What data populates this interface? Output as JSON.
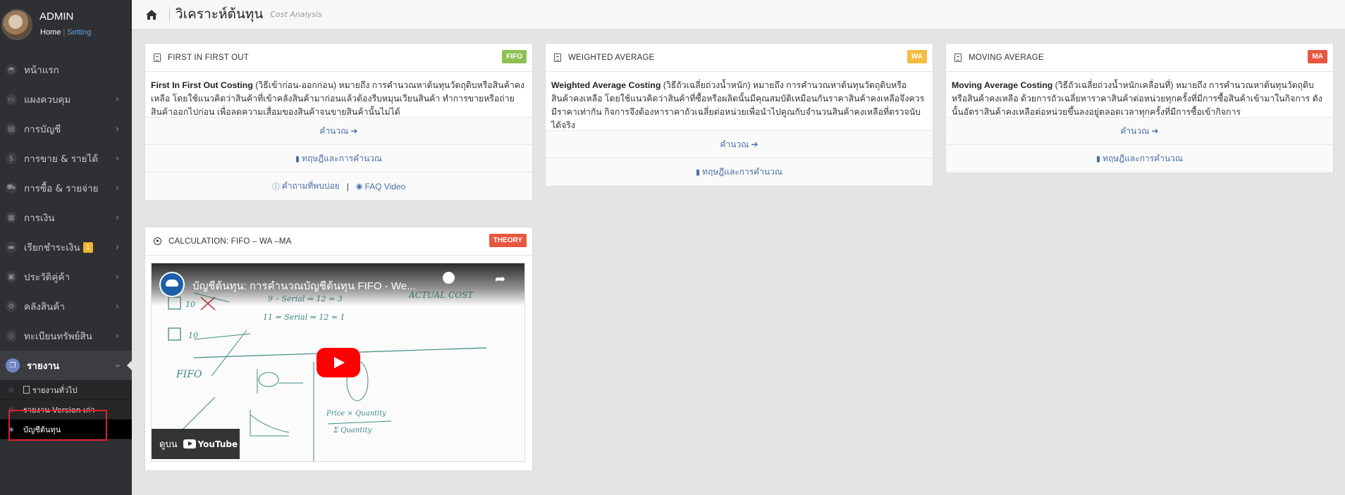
{
  "profile": {
    "name": "ADMIN",
    "home": "Home",
    "setting": "Setting"
  },
  "sidebar": {
    "items": [
      {
        "label": "หน้าแรก",
        "icon": "dashboard-icon",
        "glyph": "◓"
      },
      {
        "label": "แผงควบคุม",
        "icon": "monitor-icon",
        "glyph": "▭"
      },
      {
        "label": "การบัญชี",
        "icon": "book-icon",
        "glyph": "▤"
      },
      {
        "label": "การขาย & รายได้",
        "icon": "dollar-icon",
        "glyph": "$"
      },
      {
        "label": "การซื้อ & รายจ่าย",
        "icon": "cart-icon",
        "glyph": "⛟"
      },
      {
        "label": "การเงิน",
        "icon": "calendar-icon",
        "glyph": "▦"
      },
      {
        "label": "เรียกชำระเงิน",
        "icon": "card-icon",
        "glyph": "▬",
        "badge": "1"
      },
      {
        "label": "ประวัติคู่ค้า",
        "icon": "contacts-icon",
        "glyph": "▣"
      },
      {
        "label": "คลังสินค้า",
        "icon": "boxes-icon",
        "glyph": "⚙"
      },
      {
        "label": "ทะเบียนทรัพย์สิน",
        "icon": "diamond-icon",
        "glyph": "◇"
      }
    ],
    "active": {
      "label": "รายงาน",
      "icon": "report-icon"
    },
    "sub": [
      {
        "label": "รายงานทั่วไป"
      },
      {
        "label": "รายงาน Version เก่า"
      },
      {
        "label": "บัญชีต้นทุน"
      }
    ]
  },
  "header": {
    "title": "วิเคราะห์ต้นทุน",
    "subtitle": "Cost Analysis"
  },
  "cards": {
    "fifo": {
      "title": "FIRST IN FIRST OUT",
      "tag": "FIFO",
      "tag_color": "#8cc152",
      "term": "First In First Out Costing",
      "desc": " (วิธีเข้าก่อน-ออกก่อน) หมายถึง การคำนวณหาต้นทุนวัตถุดิบหรือสินค้าคงเหลือ โดยใช้แนวคิดว่าสินค้าที่เข้าคลังสินค้ามาก่อนแล้วต้องรีบหมุนเวียนสินค้า ทำการขายหรือถ่ายสินค้าออกไปก่อน เพื่อลดความเสื่อมของสินค้าจนขายสินค้านั้นไม่ได้",
      "calc": "คำนวณ ➔",
      "theory": "ทฤษฎีและการคำนวณ",
      "faq": "คำถามที่พบบ่อย",
      "faq_video": "FAQ Video"
    },
    "wa": {
      "title": "WEIGHTED AVERAGE",
      "tag": "WA",
      "tag_color": "#f6bb42",
      "term": "Weighted Average Costing",
      "desc": " (วิธีถัวเฉลี่ยถ่วงน้ำหนัก) หมายถึง การคำนวณหาต้นทุนวัตถุดิบหรือสินค้าคงเหลือ โดยใช้แนวคิดว่าสินค้าที่ซื้อหรือผลิตนั้นมีคุณสมบัติเหมือนกันราคาสินค้าคงเหลือจึงควรมีราคาเท่ากัน กิจการจึงต้องหาราคาถัวเฉลี่ยต่อหน่วยเพื่อนำไปคูณกับจำนวนสินค้าคงเหลือที่ตรวจนับได้จริง",
      "calc": "คำนวณ ➔",
      "theory": "ทฤษฎีและการคำนวณ"
    },
    "ma": {
      "title": "MOVING AVERAGE",
      "tag": "MA",
      "tag_color": "#e9573f",
      "term": "Moving Average Costing",
      "desc": " (วิธีถัวเฉลี่ยถ่วงน้ำหนักเคลื่อนที่) หมายถึง การคำนวณหาต้นทุนวัตถุดิบหรือสินค้าคงเหลือ ด้วยการถัวเฉลี่ยหาราคาสินค้าต่อหน่วยทุกครั้งที่มีการซื้อสินค้าเข้ามาในกิจการ ดังนั้นอัตราสินค้าคงเหลือต่อหน่วยขึ้นลงอยู่ตลอดเวลาทุกครั้งที่มีการซื้อเข้ากิจการ",
      "calc": "คำนวณ ➔",
      "theory": "ทฤษฎีและการคำนวณ"
    },
    "video": {
      "title": "CALCULATION: FIFO – WA –MA",
      "tag": "THEORY",
      "tag_color": "#e9573f",
      "video_title": "บัญชีต้นทุน: การคำนวณบัญชีต้นทุน FIFO - We...",
      "watch_on": "ดูบน",
      "youtube": "YouTube"
    }
  }
}
